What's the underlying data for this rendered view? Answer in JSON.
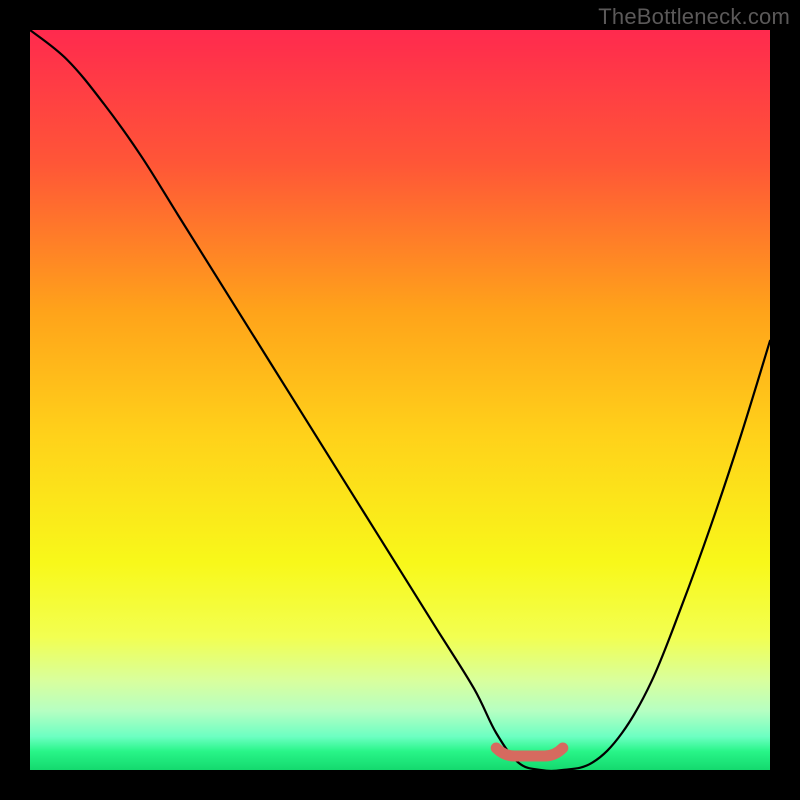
{
  "watermark": "TheBottleneck.com",
  "colors": {
    "black": "#000000",
    "curve": "#000000",
    "marker": "#d66a5f",
    "gradient_stops": [
      {
        "offset": 0.0,
        "color": "#ff2a4e"
      },
      {
        "offset": 0.18,
        "color": "#ff5637"
      },
      {
        "offset": 0.38,
        "color": "#ffa31a"
      },
      {
        "offset": 0.55,
        "color": "#ffd21a"
      },
      {
        "offset": 0.72,
        "color": "#f8f81a"
      },
      {
        "offset": 0.82,
        "color": "#f2ff51"
      },
      {
        "offset": 0.88,
        "color": "#d8ff9e"
      },
      {
        "offset": 0.92,
        "color": "#b6ffc2"
      },
      {
        "offset": 0.955,
        "color": "#6cffc2"
      },
      {
        "offset": 0.975,
        "color": "#28f588"
      },
      {
        "offset": 1.0,
        "color": "#14d96e"
      }
    ]
  },
  "chart_data": {
    "type": "line",
    "title": "",
    "xlabel": "",
    "ylabel": "",
    "xlim": [
      0,
      100
    ],
    "ylim": [
      0,
      100
    ],
    "grid": false,
    "series": [
      {
        "name": "bottleneck-curve",
        "x": [
          0,
          5,
          10,
          15,
          20,
          25,
          30,
          35,
          40,
          45,
          50,
          55,
          60,
          63,
          66,
          69,
          72,
          76,
          80,
          84,
          88,
          92,
          96,
          100
        ],
        "values": [
          100,
          96,
          90,
          83,
          75,
          67,
          59,
          51,
          43,
          35,
          27,
          19,
          11,
          5,
          1,
          0,
          0,
          1,
          5,
          12,
          22,
          33,
          45,
          58
        ]
      }
    ],
    "annotations": [
      {
        "name": "ideal-range-marker",
        "x_start": 63,
        "x_end": 72,
        "y": 0,
        "color": "#d66a5f"
      }
    ]
  }
}
